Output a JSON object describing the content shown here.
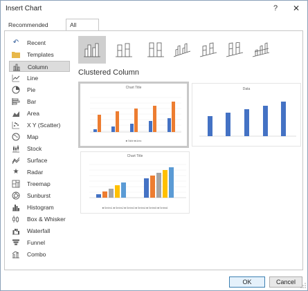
{
  "window": {
    "title": "Insert Chart",
    "help_label": "?",
    "close_label": "✕"
  },
  "tabs": [
    {
      "label": "Recommended Charts"
    },
    {
      "label": "All Charts"
    }
  ],
  "sidebar": {
    "items": [
      {
        "label": "Recent",
        "icon": "recent-icon"
      },
      {
        "label": "Templates",
        "icon": "templates-folder-icon"
      },
      {
        "label": "Column",
        "icon": "column-chart-icon"
      },
      {
        "label": "Line",
        "icon": "line-chart-icon"
      },
      {
        "label": "Pie",
        "icon": "pie-chart-icon"
      },
      {
        "label": "Bar",
        "icon": "bar-chart-icon"
      },
      {
        "label": "Area",
        "icon": "area-chart-icon"
      },
      {
        "label": "X Y (Scatter)",
        "icon": "scatter-chart-icon"
      },
      {
        "label": "Map",
        "icon": "map-chart-icon"
      },
      {
        "label": "Stock",
        "icon": "stock-chart-icon"
      },
      {
        "label": "Surface",
        "icon": "surface-chart-icon"
      },
      {
        "label": "Radar",
        "icon": "radar-chart-icon"
      },
      {
        "label": "Treemap",
        "icon": "treemap-chart-icon"
      },
      {
        "label": "Sunburst",
        "icon": "sunburst-chart-icon"
      },
      {
        "label": "Histogram",
        "icon": "histogram-chart-icon"
      },
      {
        "label": "Box & Whisker",
        "icon": "box-whisker-chart-icon"
      },
      {
        "label": "Waterfall",
        "icon": "waterfall-chart-icon"
      },
      {
        "label": "Funnel",
        "icon": "funnel-chart-icon"
      },
      {
        "label": "Combo",
        "icon": "combo-chart-icon"
      }
    ],
    "selected": "Column"
  },
  "subtypes": [
    "clustered-column-icon",
    "stacked-column-icon",
    "100-stacked-column-icon",
    "3d-clustered-column-icon",
    "3d-stacked-column-icon",
    "3d-100-stacked-column-icon",
    "3d-column-icon"
  ],
  "section_title": "Clustered Column",
  "previews": {
    "p1": {
      "title": "Chart Title",
      "legend": "■ Table ■ Area"
    },
    "p2": {
      "title": "Data"
    },
    "p3": {
      "title": "Chart Title",
      "legend": "■ Series1 ■ Series2 ■ Series3 ■ Series4 ■ Series5 ■ Series6"
    }
  },
  "colors": {
    "blue": "#4472c4",
    "orange": "#ed7d31",
    "gray": "#a5a5a5",
    "yellow": "#ffc000",
    "light_blue": "#5b9bd5",
    "selected_bg": "#cfcfcf"
  },
  "buttons": {
    "ok": "OK",
    "cancel": "Cancel"
  }
}
